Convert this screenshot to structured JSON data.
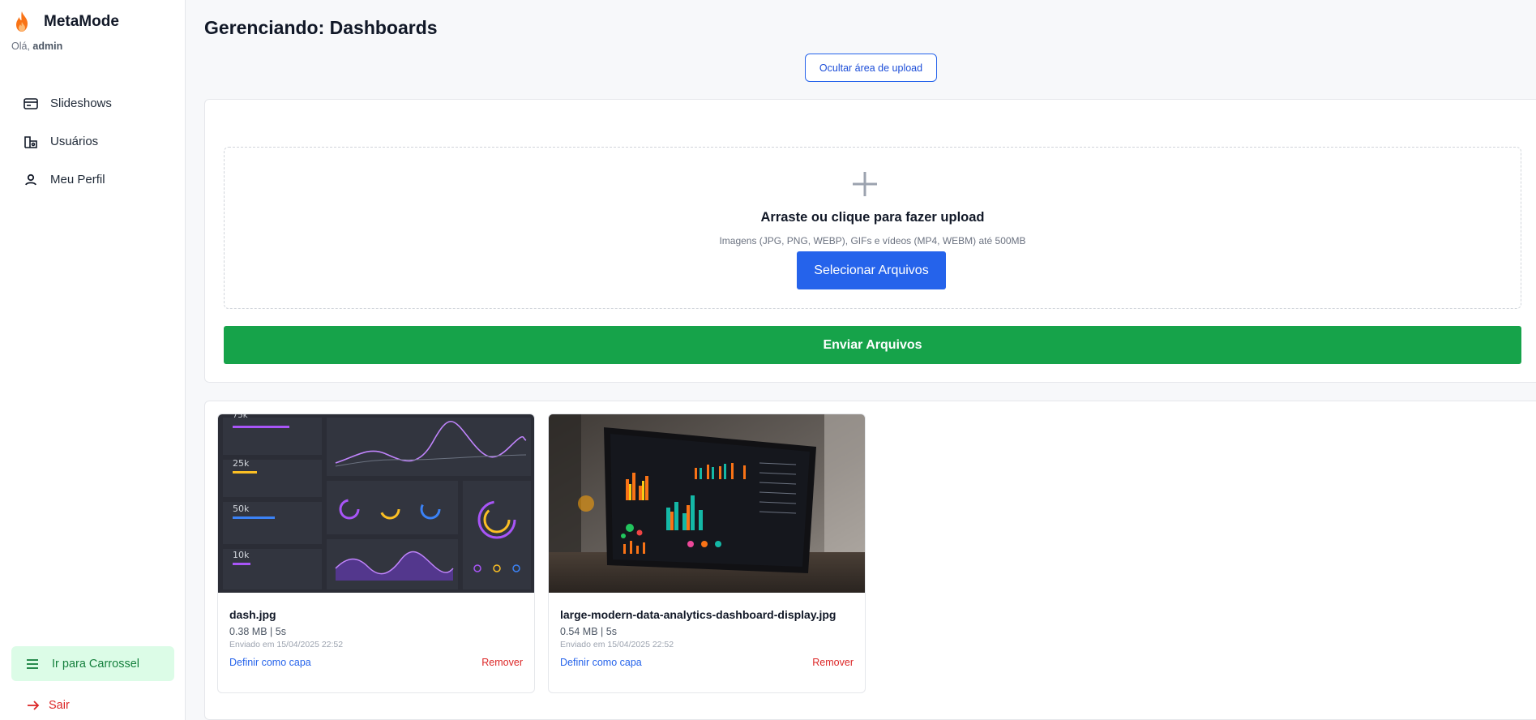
{
  "app": {
    "brand_name": "MetaMode",
    "greeting_prefix": "Olá,",
    "username": "admin"
  },
  "sidebar": {
    "items": [
      {
        "label": "Slideshows",
        "icon": "slides-icon"
      },
      {
        "label": "Usuários",
        "icon": "users-icon"
      },
      {
        "label": "Meu Perfil",
        "icon": "user-icon"
      }
    ],
    "carousel_label": "Ir para Carrossel",
    "logout_label": "Sair"
  },
  "main": {
    "title": "Gerenciando: Dashboards",
    "toggle_upload_label": "Ocultar área de upload"
  },
  "upload": {
    "title": "Arraste ou clique para fazer upload",
    "subtitle": "Imagens (JPG, PNG, WEBP), GIFs e vídeos (MP4, WEBM) até 500MB",
    "select_label": "Selecionar Arquivos",
    "send_label": "Enviar Arquivos"
  },
  "files": [
    {
      "name": "dash.jpg",
      "meta": "0.38 MB | 5s",
      "uploaded": "Enviado em 15/04/2025 22:52",
      "cover_label": "Definir como capa",
      "remove_label": "Remover"
    },
    {
      "name": "large-modern-data-analytics-dashboard-display.jpg",
      "meta": "0.54 MB | 5s",
      "uploaded": "Enviado em 15/04/2025 22:52",
      "cover_label": "Definir como capa",
      "remove_label": "Remover"
    }
  ],
  "colors": {
    "primary": "#2563eb",
    "success": "#16a34a",
    "danger": "#dc2626",
    "carousel_bg": "#dcfce7"
  }
}
